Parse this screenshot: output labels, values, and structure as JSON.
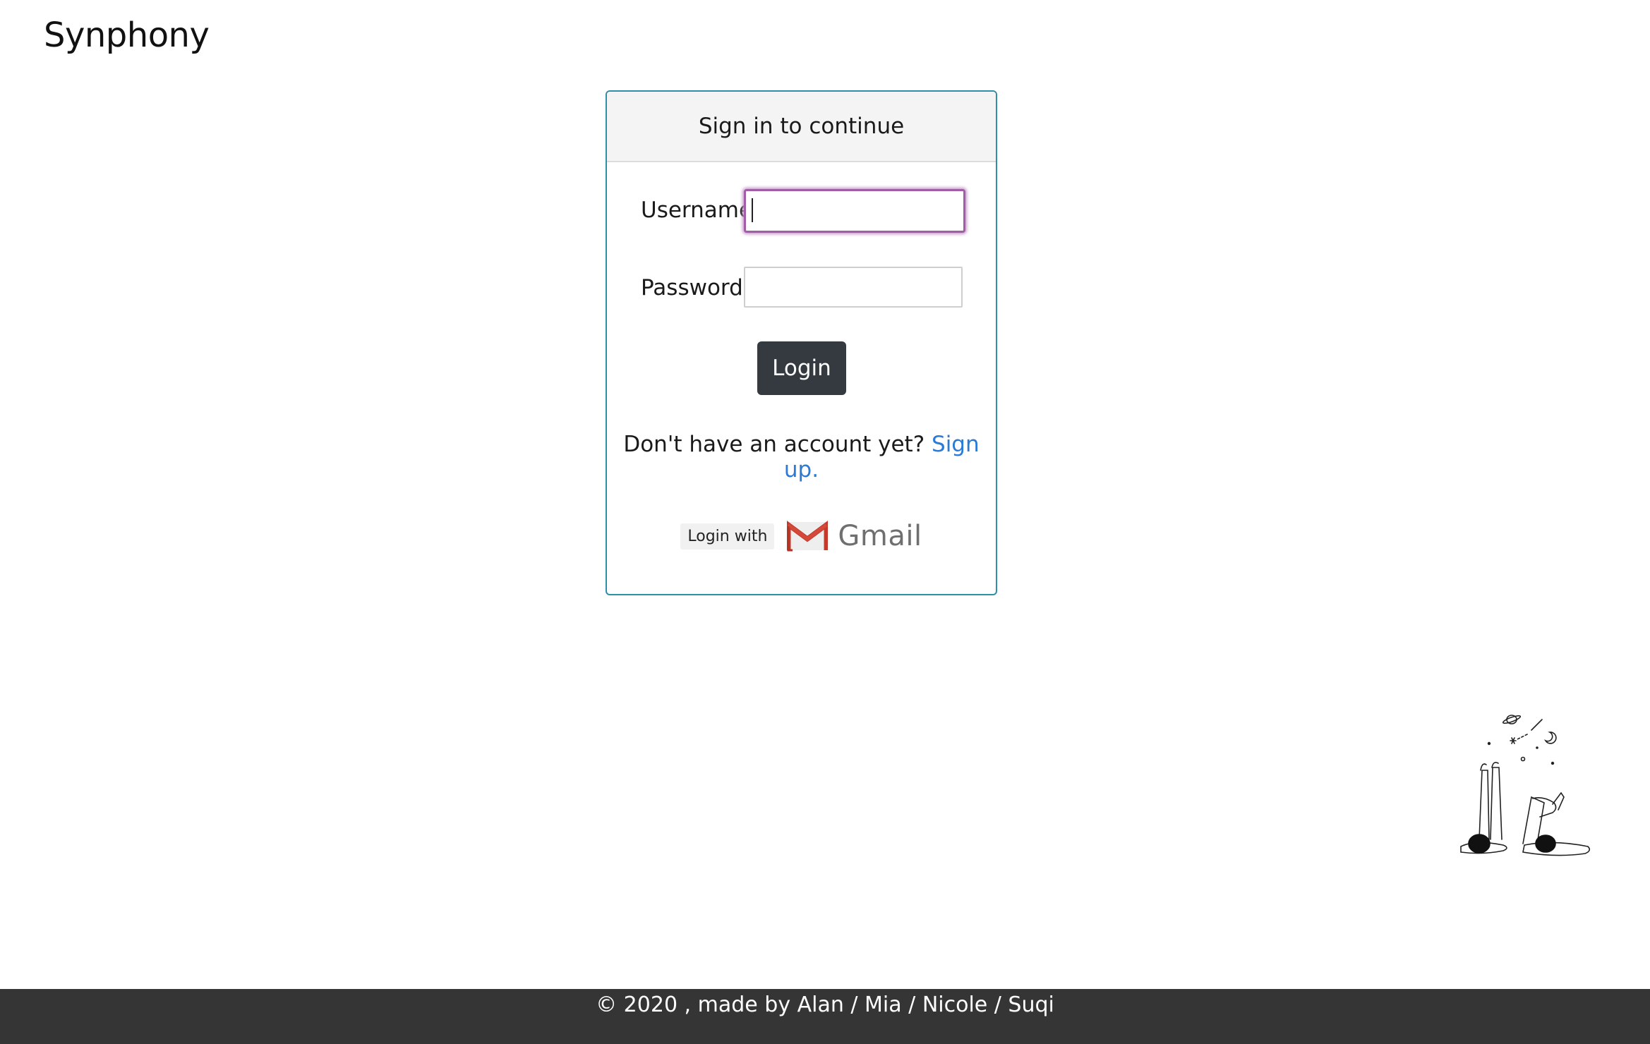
{
  "header": {
    "brand": "Synphony"
  },
  "login_card": {
    "title": "Sign in to continue",
    "username_label": "Username:",
    "username_value": "",
    "password_label": "Password:",
    "password_value": "",
    "login_button": "Login",
    "signup_prompt": "Don't have an account yet?",
    "signup_link": "Sign up.",
    "oauth_prefix": "Login with",
    "oauth_provider": "Gmail"
  },
  "colors": {
    "card_border": "#2f8fa8",
    "focus_ring": "#a35ca8",
    "login_button_bg": "#343a40",
    "link": "#2a7ad6",
    "footer_bg": "#353535",
    "gmail_red": "#c5392a"
  },
  "icons": {
    "gmail": "gmail-m-icon",
    "illustration": "stargazing-illustration"
  },
  "footer": {
    "text": "© 2020 , made by Alan / Mia / Nicole / Suqi"
  }
}
